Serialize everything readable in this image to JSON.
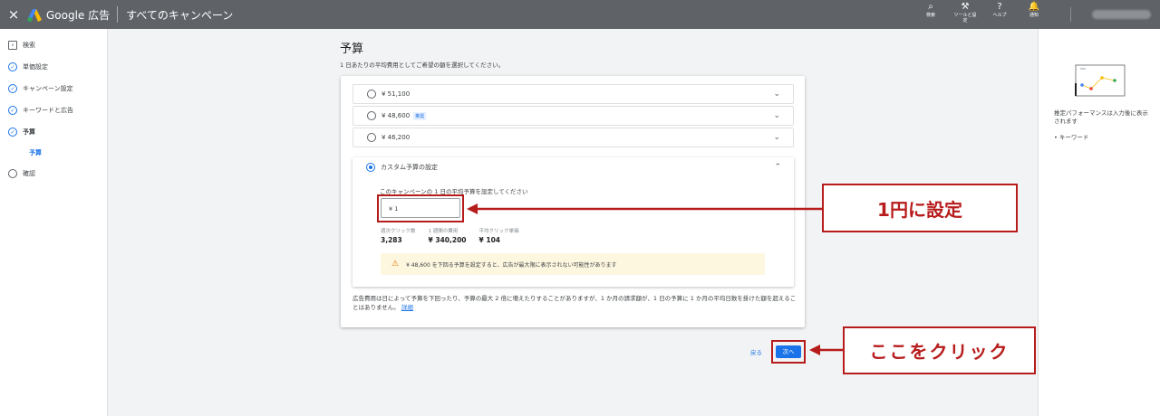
{
  "topbar": {
    "close": "×",
    "brand": "Google 広告",
    "title": "すべてのキャンペーン",
    "tools": [
      {
        "icon": "search-icon",
        "glyph": "⌕",
        "label": "検索"
      },
      {
        "icon": "wrench-icon",
        "glyph": "⚒",
        "label": "ツールと設定"
      },
      {
        "icon": "help-icon",
        "glyph": "?",
        "label": "ヘルプ"
      },
      {
        "icon": "bell-icon",
        "glyph": "🔔",
        "label": "通知"
      }
    ]
  },
  "sidebar": {
    "items": [
      {
        "label": "検索",
        "icon": "search-box-icon",
        "state": "default"
      },
      {
        "label": "単価設定",
        "icon": "check-circle-icon",
        "state": "done"
      },
      {
        "label": "キャンペーン設定",
        "icon": "check-circle-icon",
        "state": "done"
      },
      {
        "label": "キーワードと広告",
        "icon": "check-circle-icon",
        "state": "done"
      },
      {
        "label": "予算",
        "icon": "check-circle-icon",
        "state": "active"
      },
      {
        "label": "確認",
        "icon": "empty-circle-icon",
        "state": "pending"
      }
    ],
    "sub_item": "予算"
  },
  "main": {
    "title": "予算",
    "subtitle": "1 日あたりの平均費用としてご希望の額を選択してください。",
    "options": [
      {
        "label": "¥ 51,100",
        "badge": ""
      },
      {
        "label": "¥ 48,600",
        "badge": "推奨"
      },
      {
        "label": "¥ 46,200",
        "badge": ""
      }
    ],
    "custom": {
      "label": "カスタム予算の設定",
      "prompt": "このキャンペーンの 1 日の平均予算を設定してください",
      "input_value": "¥ 1",
      "stats": [
        {
          "label": "週次クリック数",
          "value": "3,283"
        },
        {
          "label": "1 週間の費用",
          "value": "¥ 340,200"
        },
        {
          "label": "平均クリック単価",
          "value": "¥ 104"
        }
      ],
      "warning": "¥ 48,600 を下回る予算を設定すると、広告が最大限に表示されない可能性があります"
    },
    "note": "広告費用は日によって予算を下回ったり、予算の最大 2 倍に増えたりすることがありますが、1 か月の請求額が、1 日の予算に 1 か月の平均日数を掛けた額を超えることはありません。",
    "note_link": "詳細"
  },
  "footer": {
    "back": "戻る",
    "next": "次へ"
  },
  "right_panel": {
    "text": "推定パフォーマンスは入力後に表示されます",
    "bullet": "• キーワード"
  },
  "annotations": {
    "callout_input": "1円に設定",
    "callout_next": "ここをクリック",
    "color": "#b71c1c"
  }
}
